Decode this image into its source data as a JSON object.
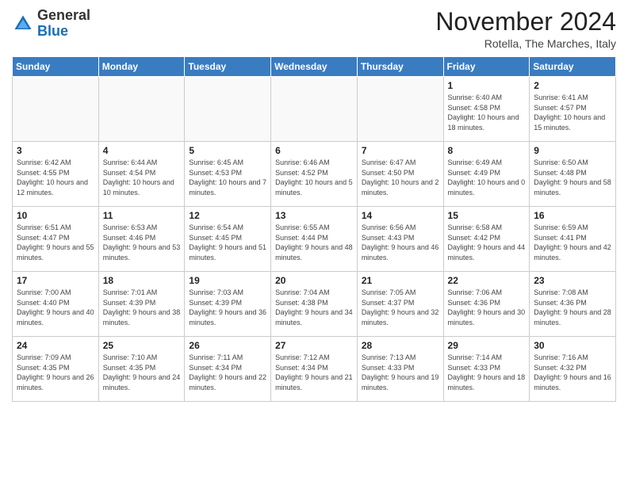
{
  "header": {
    "logo_general": "General",
    "logo_blue": "Blue",
    "month_year": "November 2024",
    "location": "Rotella, The Marches, Italy"
  },
  "weekdays": [
    "Sunday",
    "Monday",
    "Tuesday",
    "Wednesday",
    "Thursday",
    "Friday",
    "Saturday"
  ],
  "weeks": [
    [
      {
        "day": "",
        "info": ""
      },
      {
        "day": "",
        "info": ""
      },
      {
        "day": "",
        "info": ""
      },
      {
        "day": "",
        "info": ""
      },
      {
        "day": "",
        "info": ""
      },
      {
        "day": "1",
        "info": "Sunrise: 6:40 AM\nSunset: 4:58 PM\nDaylight: 10 hours and 18 minutes."
      },
      {
        "day": "2",
        "info": "Sunrise: 6:41 AM\nSunset: 4:57 PM\nDaylight: 10 hours and 15 minutes."
      }
    ],
    [
      {
        "day": "3",
        "info": "Sunrise: 6:42 AM\nSunset: 4:55 PM\nDaylight: 10 hours and 12 minutes."
      },
      {
        "day": "4",
        "info": "Sunrise: 6:44 AM\nSunset: 4:54 PM\nDaylight: 10 hours and 10 minutes."
      },
      {
        "day": "5",
        "info": "Sunrise: 6:45 AM\nSunset: 4:53 PM\nDaylight: 10 hours and 7 minutes."
      },
      {
        "day": "6",
        "info": "Sunrise: 6:46 AM\nSunset: 4:52 PM\nDaylight: 10 hours and 5 minutes."
      },
      {
        "day": "7",
        "info": "Sunrise: 6:47 AM\nSunset: 4:50 PM\nDaylight: 10 hours and 2 minutes."
      },
      {
        "day": "8",
        "info": "Sunrise: 6:49 AM\nSunset: 4:49 PM\nDaylight: 10 hours and 0 minutes."
      },
      {
        "day": "9",
        "info": "Sunrise: 6:50 AM\nSunset: 4:48 PM\nDaylight: 9 hours and 58 minutes."
      }
    ],
    [
      {
        "day": "10",
        "info": "Sunrise: 6:51 AM\nSunset: 4:47 PM\nDaylight: 9 hours and 55 minutes."
      },
      {
        "day": "11",
        "info": "Sunrise: 6:53 AM\nSunset: 4:46 PM\nDaylight: 9 hours and 53 minutes."
      },
      {
        "day": "12",
        "info": "Sunrise: 6:54 AM\nSunset: 4:45 PM\nDaylight: 9 hours and 51 minutes."
      },
      {
        "day": "13",
        "info": "Sunrise: 6:55 AM\nSunset: 4:44 PM\nDaylight: 9 hours and 48 minutes."
      },
      {
        "day": "14",
        "info": "Sunrise: 6:56 AM\nSunset: 4:43 PM\nDaylight: 9 hours and 46 minutes."
      },
      {
        "day": "15",
        "info": "Sunrise: 6:58 AM\nSunset: 4:42 PM\nDaylight: 9 hours and 44 minutes."
      },
      {
        "day": "16",
        "info": "Sunrise: 6:59 AM\nSunset: 4:41 PM\nDaylight: 9 hours and 42 minutes."
      }
    ],
    [
      {
        "day": "17",
        "info": "Sunrise: 7:00 AM\nSunset: 4:40 PM\nDaylight: 9 hours and 40 minutes."
      },
      {
        "day": "18",
        "info": "Sunrise: 7:01 AM\nSunset: 4:39 PM\nDaylight: 9 hours and 38 minutes."
      },
      {
        "day": "19",
        "info": "Sunrise: 7:03 AM\nSunset: 4:39 PM\nDaylight: 9 hours and 36 minutes."
      },
      {
        "day": "20",
        "info": "Sunrise: 7:04 AM\nSunset: 4:38 PM\nDaylight: 9 hours and 34 minutes."
      },
      {
        "day": "21",
        "info": "Sunrise: 7:05 AM\nSunset: 4:37 PM\nDaylight: 9 hours and 32 minutes."
      },
      {
        "day": "22",
        "info": "Sunrise: 7:06 AM\nSunset: 4:36 PM\nDaylight: 9 hours and 30 minutes."
      },
      {
        "day": "23",
        "info": "Sunrise: 7:08 AM\nSunset: 4:36 PM\nDaylight: 9 hours and 28 minutes."
      }
    ],
    [
      {
        "day": "24",
        "info": "Sunrise: 7:09 AM\nSunset: 4:35 PM\nDaylight: 9 hours and 26 minutes."
      },
      {
        "day": "25",
        "info": "Sunrise: 7:10 AM\nSunset: 4:35 PM\nDaylight: 9 hours and 24 minutes."
      },
      {
        "day": "26",
        "info": "Sunrise: 7:11 AM\nSunset: 4:34 PM\nDaylight: 9 hours and 22 minutes."
      },
      {
        "day": "27",
        "info": "Sunrise: 7:12 AM\nSunset: 4:34 PM\nDaylight: 9 hours and 21 minutes."
      },
      {
        "day": "28",
        "info": "Sunrise: 7:13 AM\nSunset: 4:33 PM\nDaylight: 9 hours and 19 minutes."
      },
      {
        "day": "29",
        "info": "Sunrise: 7:14 AM\nSunset: 4:33 PM\nDaylight: 9 hours and 18 minutes."
      },
      {
        "day": "30",
        "info": "Sunrise: 7:16 AM\nSunset: 4:32 PM\nDaylight: 9 hours and 16 minutes."
      }
    ]
  ]
}
